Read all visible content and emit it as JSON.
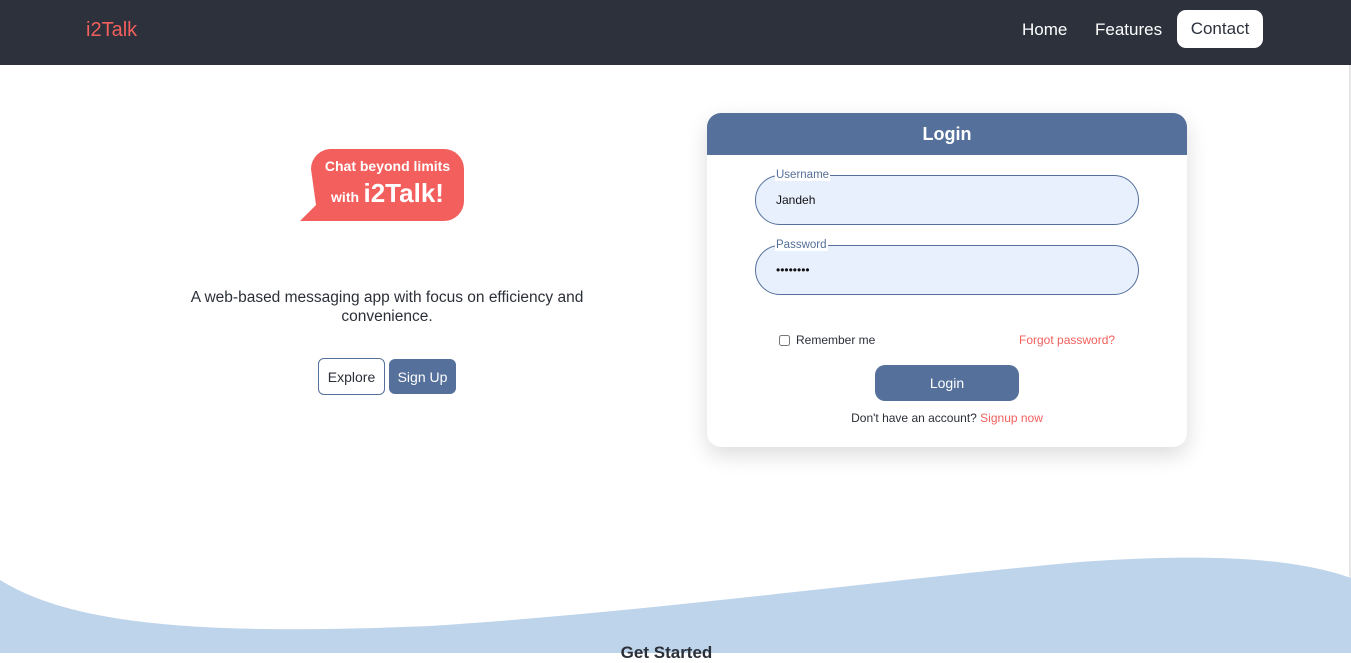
{
  "nav": {
    "brand": "i2Talk",
    "links": [
      "Home",
      "Features",
      "Contact"
    ]
  },
  "hero": {
    "bubble_line1": "Chat beyond limits",
    "bubble_with": "with",
    "bubble_brand": "i2Talk!",
    "tagline": "A web-based messaging app with focus on efficiency and convenience.",
    "explore_label": "Explore",
    "signup_label": "Sign Up"
  },
  "login": {
    "title": "Login",
    "username_label": "Username",
    "username_value": "Jandeh",
    "password_label": "Password",
    "password_value": "pass1234",
    "remember_label": "Remember me",
    "remember_checked": false,
    "forgot_label": "Forgot password?",
    "submit_label": "Login",
    "no_account_text": "Don't have an account?",
    "signup_link": "Signup now"
  },
  "section": {
    "get_started": "Get Started"
  },
  "colors": {
    "navbar_bg": "#2c313c",
    "accent_red": "#f25f5c",
    "primary_blue": "#55709a",
    "input_bg": "#e8f0fe",
    "wave_fill": "#bdd4ea"
  }
}
